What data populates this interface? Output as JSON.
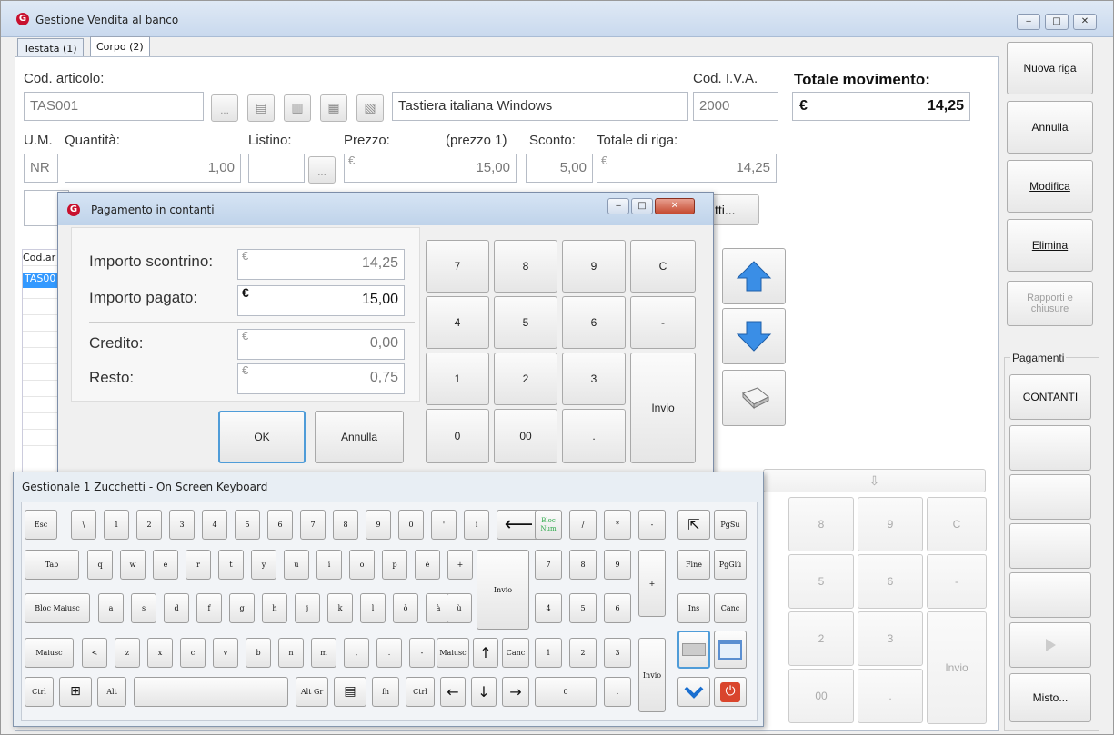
{
  "window": {
    "title": "Gestione Vendita al banco",
    "controls": [
      "‒",
      "□",
      "✕"
    ]
  },
  "tabs": [
    "Testata (1)",
    "Corpo (2)"
  ],
  "form": {
    "cod_articolo_label": "Cod. articolo:",
    "cod_articolo": "TAS001",
    "ellipsis": "...",
    "descrizione": "Tastiera italiana Windows",
    "cod_iva_label": "Cod. I.V.A.",
    "cod_iva": "2000",
    "totale_movimento_label": "Totale movimento:",
    "totale_currency": "€",
    "totale_movimento": "14,25",
    "um_label": "U.M.",
    "quantita_label": "Quantità:",
    "listino_label": "Listino:",
    "prezzo_label": "Prezzo:",
    "prezzo_note": "(prezzo 1)",
    "sconto_label": "Sconto:",
    "totale_riga_label": "Totale di riga:",
    "um": "NR",
    "quantita": "1,00",
    "prezzo": "15,00",
    "sconto": "5,00",
    "totale_riga": "14,25",
    "hidden_btn_fragment": "tti...",
    "grid_header": "Cod.ar",
    "grid_row": "TAS00"
  },
  "right_buttons": {
    "nuova_riga": "Nuova riga",
    "annulla": "Annulla",
    "modifica": "Modifica",
    "elimina": "Elimina",
    "rapporti": "Rapporti e chiusure",
    "pagamenti_label": "Pagamenti",
    "contanti": "CONTANTI",
    "misto": "Misto..."
  },
  "bg_keypad": {
    "k8": "8",
    "k9": "9",
    "kc": "C",
    "k5": "5",
    "k6": "6",
    "kminus": "-",
    "k2": "2",
    "k3": "3",
    "k00": "00",
    "kdot": ".",
    "invio": "Invio",
    "arrow": "⇩"
  },
  "dialog": {
    "title": "Pagamento in contanti",
    "controls": [
      "‒",
      "□",
      "✕"
    ],
    "importo_scontrino_label": "Importo scontrino:",
    "importo_scontrino": "14,25",
    "importo_pagato_label": "Importo pagato:",
    "importo_pagato": "15,00",
    "credito_label": "Credito:",
    "credito": "0,00",
    "resto_label": "Resto:",
    "resto": "0,75",
    "currency": "€",
    "ok": "OK",
    "annulla": "Annulla",
    "keypad": [
      "7",
      "8",
      "9",
      "C",
      "4",
      "5",
      "6",
      "-",
      "1",
      "2",
      "3",
      "0",
      "00",
      ".",
      "Invio"
    ]
  },
  "osk": {
    "title": "Gestionale 1 Zucchetti - On Screen Keyboard",
    "row1": [
      "Esc",
      "\\",
      "1",
      "2",
      "3",
      "4",
      "5",
      "6",
      "7",
      "8",
      "9",
      "0",
      "'",
      "ì"
    ],
    "backspace": "⟵",
    "bloc_num": "Bloc Num",
    "numpad_top": [
      "/",
      "*",
      "-"
    ],
    "row2": [
      "Tab",
      "q",
      "w",
      "e",
      "r",
      "t",
      "y",
      "u",
      "i",
      "o",
      "p",
      "è",
      "+"
    ],
    "invio": "Invio",
    "row3": [
      "Bloc Maiusc",
      "a",
      "s",
      "d",
      "f",
      "g",
      "h",
      "j",
      "k",
      "l",
      "ò",
      "à",
      "ù"
    ],
    "row4": [
      "Maiusc",
      "<",
      "z",
      "x",
      "c",
      "v",
      "b",
      "n",
      "m",
      ",",
      ".",
      "-",
      "Maiusc"
    ],
    "row5": [
      "Ctrl",
      "Alt",
      "Alt Gr",
      "fn",
      "Ctrl"
    ],
    "canc": "Canc",
    "numpad": [
      "7",
      "8",
      "9",
      "4",
      "5",
      "6",
      "1",
      "2",
      "3",
      "0",
      "."
    ],
    "plus": "+",
    "np_invio": "Invio",
    "nav": [
      "PgSu",
      "Fine",
      "PgGiù",
      "Ins",
      "Canc"
    ],
    "arrows": [
      "↑",
      "←",
      "↓",
      "→",
      "⇱"
    ]
  }
}
